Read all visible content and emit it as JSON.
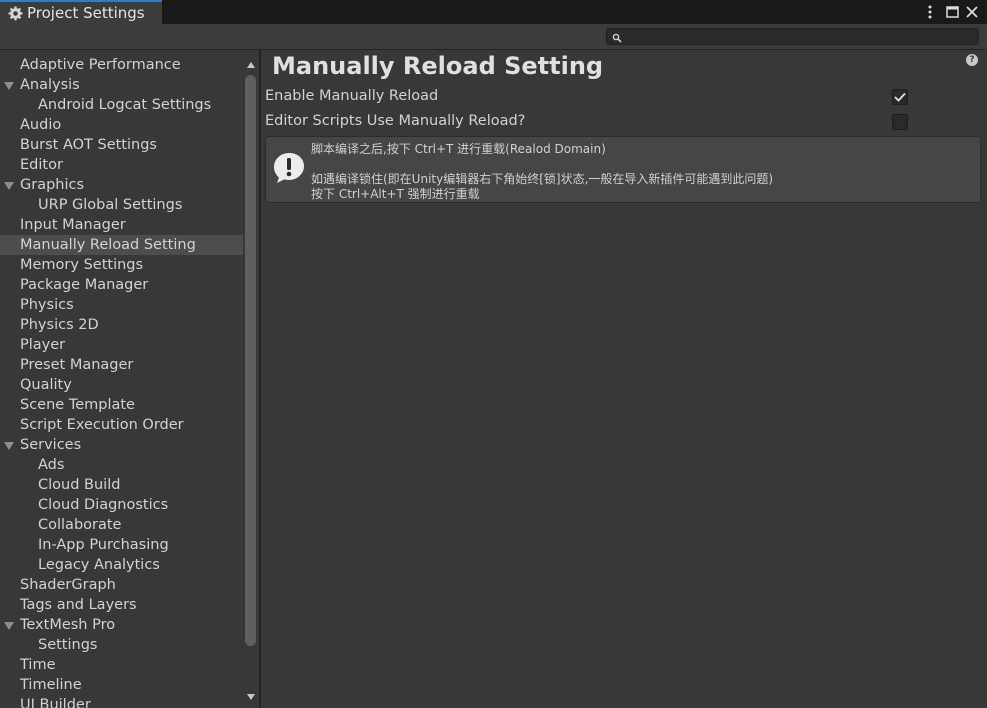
{
  "window": {
    "title": "Project Settings",
    "icons": {
      "tab": "gear-icon",
      "menu": "kebab-menu-icon",
      "maximize": "maximize-icon",
      "close": "close-icon"
    }
  },
  "search": {
    "placeholder": "",
    "value": ""
  },
  "sidebar": {
    "items": [
      {
        "label": "Adaptive Performance",
        "level": 0
      },
      {
        "label": "Analysis",
        "level": 0,
        "expandable": true
      },
      {
        "label": "Android Logcat Settings",
        "level": 1
      },
      {
        "label": "Audio",
        "level": 0
      },
      {
        "label": "Burst AOT Settings",
        "level": 0
      },
      {
        "label": "Editor",
        "level": 0
      },
      {
        "label": "Graphics",
        "level": 0,
        "expandable": true
      },
      {
        "label": "URP Global Settings",
        "level": 1
      },
      {
        "label": "Input Manager",
        "level": 0
      },
      {
        "label": "Manually Reload Setting",
        "level": 0,
        "selected": true
      },
      {
        "label": "Memory Settings",
        "level": 0
      },
      {
        "label": "Package Manager",
        "level": 0
      },
      {
        "label": "Physics",
        "level": 0
      },
      {
        "label": "Physics 2D",
        "level": 0
      },
      {
        "label": "Player",
        "level": 0
      },
      {
        "label": "Preset Manager",
        "level": 0
      },
      {
        "label": "Quality",
        "level": 0
      },
      {
        "label": "Scene Template",
        "level": 0
      },
      {
        "label": "Script Execution Order",
        "level": 0
      },
      {
        "label": "Services",
        "level": 0,
        "expandable": true
      },
      {
        "label": "Ads",
        "level": 1
      },
      {
        "label": "Cloud Build",
        "level": 1
      },
      {
        "label": "Cloud Diagnostics",
        "level": 1
      },
      {
        "label": "Collaborate",
        "level": 1
      },
      {
        "label": "In-App Purchasing",
        "level": 1
      },
      {
        "label": "Legacy Analytics",
        "level": 1
      },
      {
        "label": "ShaderGraph",
        "level": 0
      },
      {
        "label": "Tags and Layers",
        "level": 0
      },
      {
        "label": "TextMesh Pro",
        "level": 0,
        "expandable": true
      },
      {
        "label": "Settings",
        "level": 1
      },
      {
        "label": "Time",
        "level": 0
      },
      {
        "label": "Timeline",
        "level": 0
      },
      {
        "label": "UI Builder",
        "level": 0
      }
    ]
  },
  "main": {
    "title": "Manually Reload Setting",
    "fields": [
      {
        "label": "Enable Manually Reload",
        "checked": true
      },
      {
        "label": "Editor Scripts Use Manually Reload?",
        "checked": false
      }
    ],
    "helpbox": {
      "icon": "warning-icon",
      "lines": [
        "脚本编译之后,按下 Ctrl+T 进行重载(Realod Domain)",
        "",
        "如遇编译锁住(即在Unity编辑器右下角始终[锁]状态,一般在导入新插件可能遇到此问题)",
        "按下 Ctrl+Alt+T 强制进行重载"
      ]
    }
  },
  "colors": {
    "background": "#383838",
    "selected": "#4d4d4d",
    "tab_accent": "#3a79bb"
  }
}
